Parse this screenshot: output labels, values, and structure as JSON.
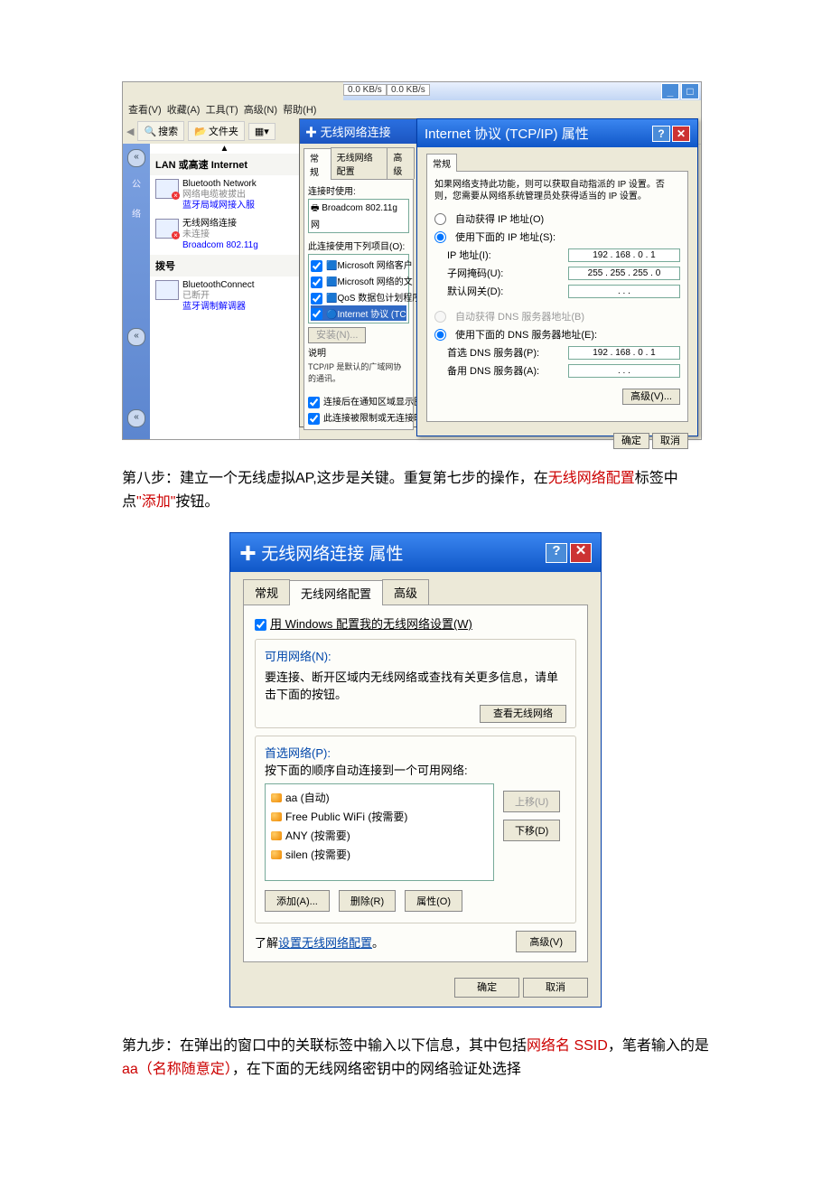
{
  "scr1": {
    "kb1": "0.0 KB/s",
    "kb2": "0.0 KB/s",
    "menu": {
      "view": "查看(V)",
      "fav": "收藏(A)",
      "tools": "工具(T)",
      "adv": "高级(N)",
      "help": "帮助(H)"
    },
    "tbar": {
      "search": "搜索",
      "folders": "文件夹"
    },
    "side": {
      "pub": "公",
      "net": "络"
    },
    "main": {
      "hd": "LAN 或高速 Internet",
      "c1": {
        "t": "Bluetooth Network",
        "s1": "网络电缆被拔出",
        "s2": "蓝牙局域网接入服"
      },
      "c2": {
        "t": "无线网络连接",
        "s1": "未连接",
        "s2": "Broadcom 802.11g"
      },
      "dial": "拨号",
      "c3": {
        "t": "BluetoothConnect",
        "s1": "已断开",
        "s2": "蓝牙调制解调器"
      }
    },
    "dlg1": {
      "title": "无线网络连接",
      "tabs": {
        "t1": "常规",
        "t2": "无线网络配置",
        "t3": "高级"
      },
      "conn": "连接时使用:",
      "adapter": "Broadcom 802.11g 网",
      "uses": "此连接使用下列项目(O):",
      "items": [
        "Microsoft 网络客户",
        "Microsoft 网络的文",
        "QoS 数据包计划程序",
        "Internet 协议 (TC"
      ],
      "install": "安装(N)...",
      "desc": "说明",
      "desctxt": "TCP/IP 是默认的广域网协的通讯。",
      "chk1": "连接后在通知区域显示图",
      "chk2": "此连接被限制或无连接时"
    },
    "dlg2": {
      "title": "Internet 协议 (TCP/IP) 属性",
      "tab": "常规",
      "info": "如果网络支持此功能，则可以获取自动指派的 IP 设置。否则，您需要从网络系统管理员处获得适当的 IP 设置。",
      "r1": "自动获得 IP 地址(O)",
      "r2": "使用下面的 IP 地址(S):",
      "ip_l": "IP 地址(I):",
      "ip_v": "192 . 168 .  0  .  1",
      "mask_l": "子网掩码(U):",
      "mask_v": "255 . 255 . 255 .  0",
      "gw_l": "默认网关(D):",
      "gw_v": " .       .       . ",
      "r3": "自动获得 DNS 服务器地址(B)",
      "r4": "使用下面的 DNS 服务器地址(E):",
      "dns1_l": "首选 DNS 服务器(P):",
      "dns1_v": "192 . 168 .  0  .  1",
      "dns2_l": "备用 DNS 服务器(A):",
      "dns2_v": " .       .       . ",
      "adv": "高级(V)...",
      "ok": "确定",
      "cancel": "取消"
    }
  },
  "p8": {
    "pre": "第八步：建立一个无线虚拟AP,这步是关键。重复第七步的操作，在",
    "r1": "无线网络配置",
    "mid": "标签中点",
    "r2": "\"添加\"",
    "post": "按钮。"
  },
  "scr2": {
    "title": "无线网络连接 属性",
    "tabs": {
      "t1": "常规",
      "t2": "无线网络配置",
      "t3": "高级"
    },
    "usewin": "用 Windows 配置我的无线网络设置(W)",
    "g1": {
      "t": "可用网络(N):",
      "txt": "要连接、断开区域内无线网络或查找有关更多信息，请单击下面的按钮。",
      "btn": "查看无线网络"
    },
    "g2": {
      "t": "首选网络(P):",
      "txt": "按下面的顺序自动连接到一个可用网络:",
      "items": [
        "aa (自动)",
        "Free Public WiFi (按需要)",
        "ANY (按需要)",
        "silen (按需要)"
      ],
      "up": "上移(U)",
      "down": "下移(D)",
      "add": "添加(A)...",
      "del": "删除(R)",
      "prop": "属性(O)"
    },
    "learn_pre": "了解",
    "learn_link": "设置无线网络配置",
    "learn_post": "。",
    "adv": "高级(V)",
    "ok": "确定",
    "cancel": "取消"
  },
  "p9": {
    "pre": "第九步：在弹出的窗口中的关联标签中输入以下信息，其中包括",
    "r1": "网络名 SSID",
    "mid": "，笔者输入的是",
    "r2": "aa（名称随意定）",
    "post": "，在下面的无线网络密钥中的网络验证处选择"
  }
}
